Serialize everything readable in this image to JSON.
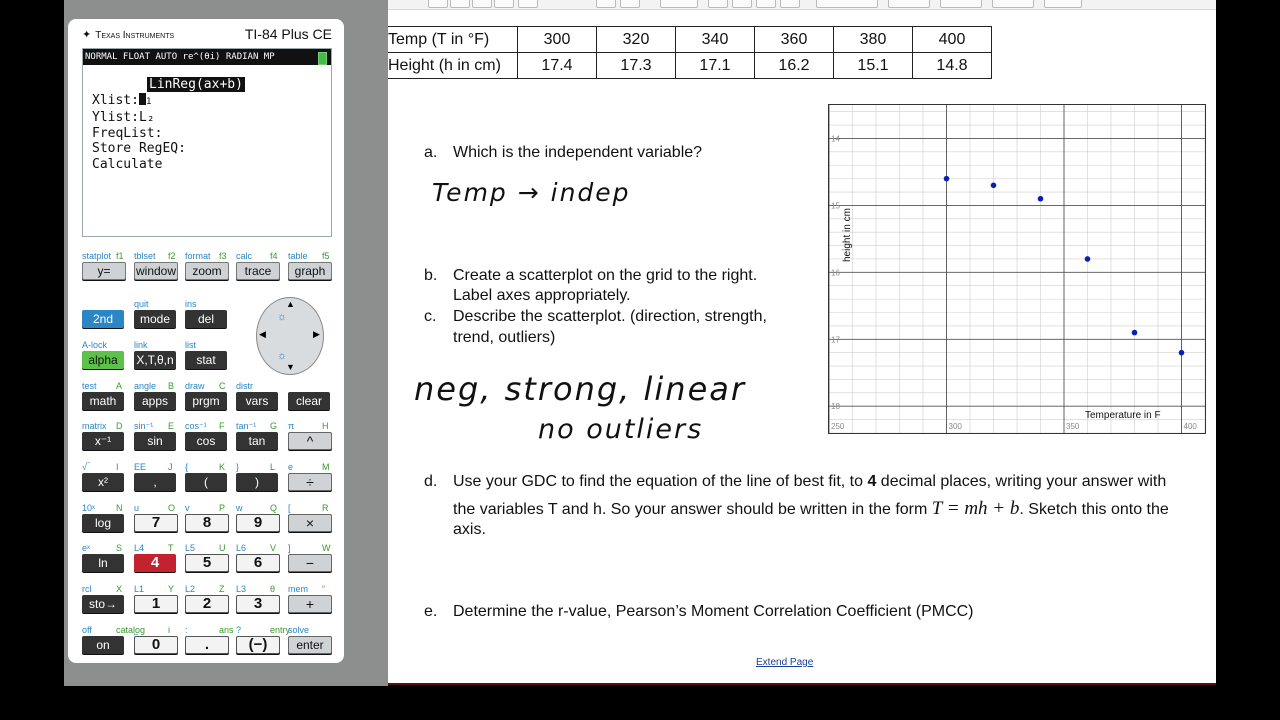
{
  "calculator": {
    "brand": "Texas Instruments",
    "model": "TI-84 Plus CE",
    "status_bar": "NORMAL FLOAT AUTO re^(θi) RADIAN MP",
    "screen_title": "LinReg(ax+b)",
    "screen_lines": [
      "Xlist:",
      "Ylist:L₂",
      "FreqList:",
      "Store RegEQ:",
      "Calculate"
    ],
    "xlist_value": "1",
    "row1_labels": [
      "statplot",
      "f1",
      "tblset",
      "f2",
      "format",
      "f3",
      "calc",
      "f4",
      "table",
      "f5"
    ],
    "row1_keys": [
      "y=",
      "window",
      "zoom",
      "trace",
      "graph"
    ],
    "row2_labels": [
      "quit",
      "ins"
    ],
    "row2_keys": [
      "2nd",
      "mode",
      "del"
    ],
    "row3_labels": [
      "A-lock",
      "link",
      "list"
    ],
    "row3_keys": [
      "alpha",
      "X,T,θ,n",
      "stat"
    ],
    "row4_labels": [
      "test",
      "A",
      "angle",
      "B",
      "draw",
      "C",
      "distr"
    ],
    "row4_keys": [
      "math",
      "apps",
      "prgm",
      "vars",
      "clear"
    ],
    "row5_labels": [
      "matrix",
      "D",
      "sin⁻¹",
      "E",
      "cos⁻¹",
      "F",
      "tan⁻¹",
      "G",
      "π",
      "H"
    ],
    "row5_keys": [
      "x⁻¹",
      "sin",
      "cos",
      "tan",
      "^"
    ],
    "row6_labels": [
      "√‾",
      "I",
      "EE",
      "J",
      "{",
      "K",
      "}",
      "L",
      "e",
      "M"
    ],
    "row6_keys": [
      "x²",
      ",",
      "(",
      ")",
      "÷"
    ],
    "row7_labels": [
      "10ˣ",
      "N",
      "u",
      "O",
      "v",
      "P",
      "w",
      "Q",
      "[",
      "R"
    ],
    "row7_keys": [
      "log",
      "7",
      "8",
      "9",
      "×"
    ],
    "row8_labels": [
      "eˣ",
      "S",
      "L4",
      "T",
      "L5",
      "U",
      "L6",
      "V",
      "]",
      "W"
    ],
    "row8_keys": [
      "ln",
      "4",
      "5",
      "6",
      "−"
    ],
    "row9_labels": [
      "rcl",
      "X",
      "L1",
      "Y",
      "L2",
      "Z",
      "L3",
      "θ",
      "mem",
      "“"
    ],
    "row9_keys": [
      "sto→",
      "1",
      "2",
      "3",
      "+"
    ],
    "row10_labels": [
      "off",
      "catalog",
      "⎵",
      "i",
      ":",
      "ans",
      "?",
      "entry",
      "solve"
    ],
    "row10_keys": [
      "on",
      "0",
      ".",
      "(−)",
      "enter"
    ]
  },
  "document": {
    "table": {
      "row1": [
        "Temp (T in °F)",
        "300",
        "320",
        "340",
        "360",
        "380",
        "400"
      ],
      "row2": [
        "Height (h in cm)",
        "17.4",
        "17.3",
        "17.1",
        "16.2",
        "15.1",
        "14.8"
      ]
    },
    "questions": {
      "a_letter": "a.",
      "a_text": "Which is the independent variable?",
      "a_answer": "Temp → indep",
      "b_letter": "b.",
      "b_line1": "Create a scatterplot on the grid to the right.",
      "b_line2": "Label axes appropriately.",
      "c_letter": "c.",
      "c_line1": "Describe the scatterplot. (direction, strength,",
      "c_line2": "trend, outliers)",
      "c_answer1": "neg, strong, linear",
      "c_answer2": "no outliers",
      "d_letter": "d.",
      "d_line1_pre": "Use your GDC to find the equation of the line of best fit, to ",
      "d_line1_bold": "4",
      "d_line1_post": " decimal places, writing your answer with",
      "d_line2_pre": "the variables T and h. So your answer should be written in the form ",
      "d_formula": "T = mh + b",
      "d_line2_post": ". Sketch this onto the",
      "d_line3": "axis.",
      "e_letter": "e.",
      "e_text": "Determine the r-value, Pearson’s Moment Correlation Coefficient (PMCC)"
    },
    "graph": {
      "x_axis_label": "Temperature in F",
      "y_axis_label": "height in cm",
      "x_ticks": [
        "250",
        "300",
        "350",
        "400"
      ],
      "y_ticks": [
        "18",
        "17",
        "16",
        "15",
        "14"
      ]
    },
    "extend_page": "Extend Page"
  },
  "chart_data": {
    "type": "scatter",
    "xlabel": "Temperature in F",
    "ylabel": "height in cm",
    "xlim": [
      250,
      410
    ],
    "ylim": [
      13.6,
      18.5
    ],
    "x_ticks": [
      250,
      300,
      350,
      400
    ],
    "y_ticks": [
      14,
      15,
      16,
      17,
      18
    ],
    "grid": true,
    "points": [
      {
        "x": 300,
        "y": 17.4
      },
      {
        "x": 320,
        "y": 17.3
      },
      {
        "x": 340,
        "y": 17.1
      },
      {
        "x": 360,
        "y": 16.2
      },
      {
        "x": 380,
        "y": 15.1
      },
      {
        "x": 400,
        "y": 14.8
      }
    ],
    "point_color": "#0a1fb8"
  }
}
